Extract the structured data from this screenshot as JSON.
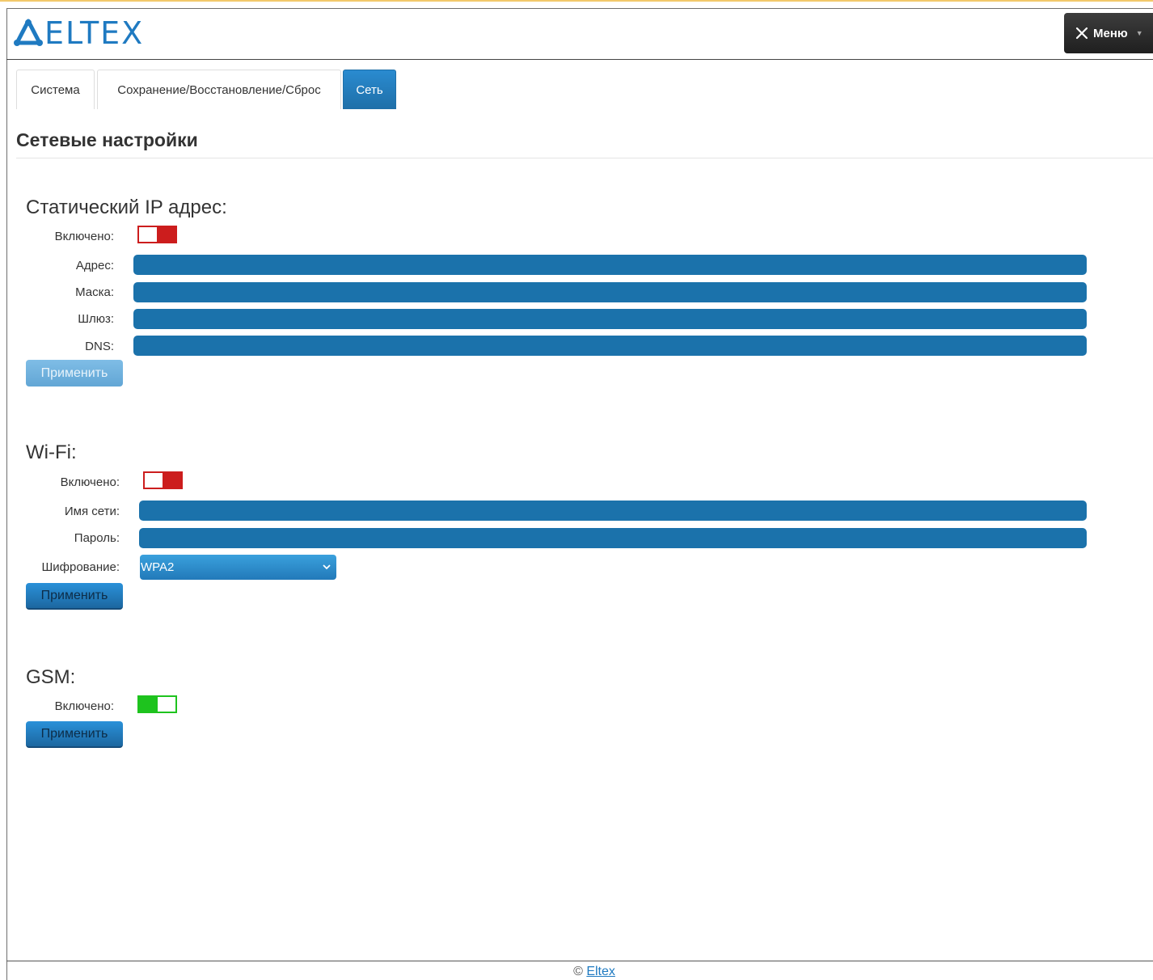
{
  "header": {
    "logo_text": "ELTEX",
    "menu_label": "Меню",
    "menu_icon": "tools-icon"
  },
  "tabs": [
    {
      "label": "Система",
      "active": false
    },
    {
      "label": "Сохранение/Восстановление/Сброс",
      "active": false
    },
    {
      "label": "Сеть",
      "active": true
    }
  ],
  "page_title": "Сетевые настройки",
  "static_ip": {
    "title": "Статический IP адрес:",
    "enabled_label": "Включено:",
    "enabled": false,
    "address_label": "Адрес:",
    "address_value": "",
    "mask_label": "Маска:",
    "mask_value": "",
    "gateway_label": "Шлюз:",
    "gateway_value": "",
    "dns_label": "DNS:",
    "dns_value": "",
    "apply_label": "Применить",
    "apply_disabled": true
  },
  "wifi": {
    "title": "Wi-Fi:",
    "enabled_label": "Включено:",
    "enabled": false,
    "ssid_label": "Имя сети:",
    "ssid_value": "",
    "password_label": "Пароль:",
    "password_value": "",
    "encryption_label": "Шифрование:",
    "encryption_value": "WPA2",
    "apply_label": "Применить"
  },
  "gsm": {
    "title": "GSM:",
    "enabled_label": "Включено:",
    "enabled": true,
    "apply_label": "Применить"
  },
  "footer": {
    "copyright": "©",
    "link_text": "Eltex"
  },
  "colors": {
    "accent": "#1f7ac1",
    "field": "#1b72ab",
    "toggle_off": "#cc1d1d",
    "toggle_on": "#1ec31e"
  }
}
